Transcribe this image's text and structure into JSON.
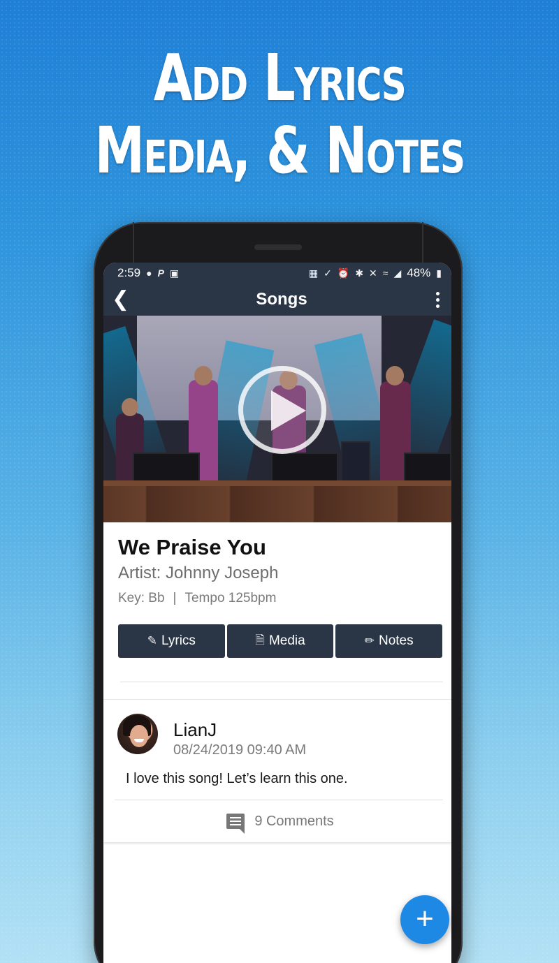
{
  "headline": {
    "line1": "Add Lyrics",
    "line2": "Media, & Notes"
  },
  "status_bar": {
    "time": "2:59",
    "battery": "48%",
    "icons_left": [
      "location-icon",
      "paypal-icon",
      "image-icon"
    ],
    "icons_right": [
      "nfc-icon",
      "edit-icon",
      "alarm-icon",
      "bluetooth-icon",
      "mute-icon",
      "wifi-icon",
      "signal-icon",
      "battery-icon"
    ]
  },
  "app_bar": {
    "title": "Songs",
    "back_icon": "chevron-left-icon",
    "menu_icon": "more-vertical-icon"
  },
  "song": {
    "title": "We Praise You",
    "artist": "Artist: Johnny Joseph",
    "key": "Key: Bb",
    "separator": "|",
    "tempo": "Tempo 125bpm"
  },
  "tabs": [
    {
      "label": "Lyrics",
      "icon": "lyrics-icon"
    },
    {
      "label": "Media",
      "icon": "document-icon"
    },
    {
      "label": "Notes",
      "icon": "notes-icon"
    }
  ],
  "comment": {
    "user": "LianJ",
    "date": "08/24/2019 09:40 AM",
    "text": "I love this song! Let’s learn this one.",
    "comments_count": "9 Comments"
  },
  "fab_label": "+",
  "colors": {
    "primary": "#2a3546",
    "accent": "#1e88e5",
    "background_top": "#1f7fd6",
    "background_bottom": "#b2e1f5"
  }
}
